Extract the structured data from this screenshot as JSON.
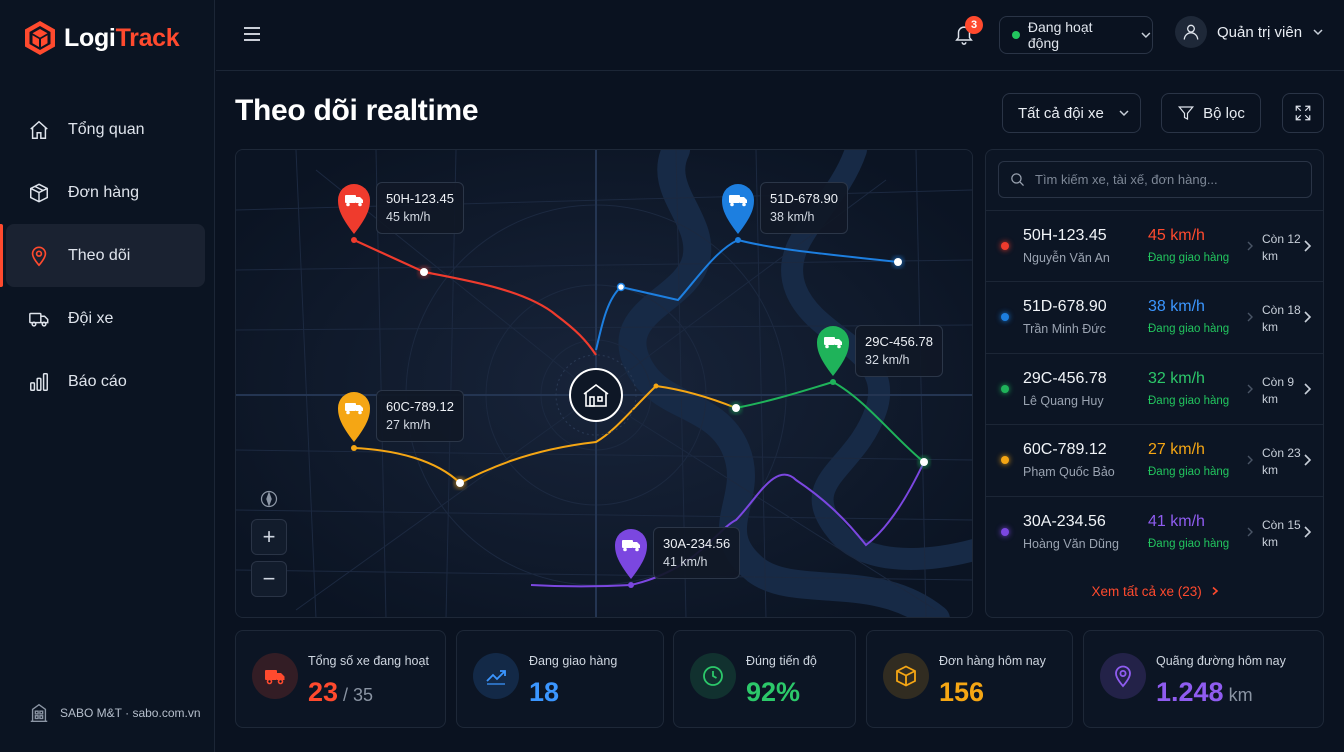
{
  "app": {
    "logo_part1": "Logi",
    "logo_part2": "Track",
    "footer": "SABO M&T · sabo.com.vn"
  },
  "sidebar": {
    "items": [
      {
        "label": "Tổng quan",
        "icon": "home-icon",
        "active": false
      },
      {
        "label": "Đơn hàng",
        "icon": "box-icon",
        "active": false
      },
      {
        "label": "Theo dõi",
        "icon": "location-pin-icon",
        "active": true
      },
      {
        "label": "Đội xe",
        "icon": "truck-icon",
        "active": false
      },
      {
        "label": "Báo cáo",
        "icon": "bar-chart-icon",
        "active": false
      }
    ]
  },
  "header": {
    "notifications": "3",
    "status": "Đang hoạt động",
    "user": "Quản trị viên"
  },
  "page": {
    "title": "Theo dõi realtime",
    "fleet_select": "Tất cả đội xe",
    "filter_label": "Bộ lọc"
  },
  "map": {
    "labels": [
      {
        "plate": "50H-123.45",
        "speed": "45 km/h",
        "color": "#ef3b2d"
      },
      {
        "plate": "51D-678.90",
        "speed": "38 km/h",
        "color": "#1d7fe0"
      },
      {
        "plate": "29C-456.78",
        "speed": "32 km/h",
        "color": "#1fb35a"
      },
      {
        "plate": "60C-789.12",
        "speed": "27 km/h",
        "color": "#f5a614"
      },
      {
        "plate": "30A-234.56",
        "speed": "41 km/h",
        "color": "#7b47e0"
      }
    ],
    "zoom_in": "+",
    "zoom_out": "−"
  },
  "vehicles": {
    "search_placeholder": "Tìm kiếm xe, tài xế, đơn hàng...",
    "rows": [
      {
        "plate": "50H-123.45",
        "driver": "Nguyễn Văn An",
        "speed": "45 km/h",
        "state": "Đang giao hàng",
        "remaining": "Còn 12 km",
        "color": "#ef3b2d",
        "speed_color": "#ff4a2e"
      },
      {
        "plate": "51D-678.90",
        "driver": "Trần Minh Đức",
        "speed": "38 km/h",
        "state": "Đang giao hàng",
        "remaining": "Còn 18 km",
        "color": "#1d7fe0",
        "speed_color": "#3b96ff"
      },
      {
        "plate": "29C-456.78",
        "driver": "Lê Quang Huy",
        "speed": "32 km/h",
        "state": "Đang giao hàng",
        "remaining": "Còn 9 km",
        "color": "#1fb35a",
        "speed_color": "#2cc86a"
      },
      {
        "plate": "60C-789.12",
        "driver": "Phạm Quốc Bảo",
        "speed": "27 km/h",
        "state": "Đang giao hàng",
        "remaining": "Còn 23 km",
        "color": "#f5a614",
        "speed_color": "#f5a614"
      },
      {
        "plate": "30A-234.56",
        "driver": "Hoàng Văn Dũng",
        "speed": "41 km/h",
        "state": "Đang giao hàng",
        "remaining": "Còn 15 km",
        "color": "#7b47e0",
        "speed_color": "#8f5cf0"
      }
    ],
    "see_all": "Xem tất cả xe (23)"
  },
  "stats": [
    {
      "label": "Tổng số xe đang hoạt",
      "value": "23",
      "sub": " / 35",
      "color": "#ff4a2e",
      "icon": "truck-icon"
    },
    {
      "label": "Đang giao hàng",
      "value": "18",
      "sub": "",
      "color": "#3b96ff",
      "icon": "trend-icon"
    },
    {
      "label": "Đúng tiến độ",
      "value": "92%",
      "sub": "",
      "color": "#2cc86a",
      "icon": "clock-icon"
    },
    {
      "label": "Đơn hàng hôm nay",
      "value": "156",
      "sub": "",
      "color": "#f5a614",
      "icon": "package-icon"
    },
    {
      "label": "Quãng đường hôm nay",
      "value": "1.248",
      "sub": " km",
      "color": "#8f5cf0",
      "icon": "location-pin-icon"
    }
  ]
}
